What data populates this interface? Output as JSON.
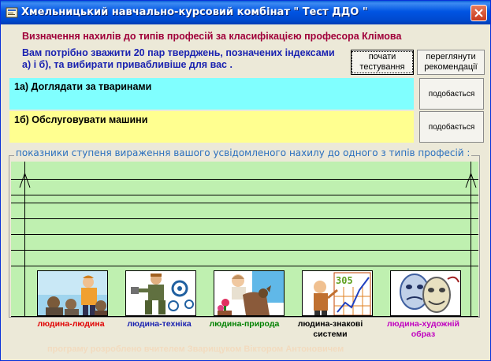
{
  "window": {
    "title": "Хмельницький навчально-курсовий комбінат \" Тест ДДО \""
  },
  "heading": "Визначення нахилів до типів професій за класифікацією професора Клімова",
  "instructions": "Вам потрібно зважити  20 пар тверджень, позначених індексами а) і б), та вибирати привабливіше для вас .",
  "buttons": {
    "start": "почати тестування",
    "recommendations": "переглянути рекомендації",
    "like": "подобається"
  },
  "statements": {
    "a": "1а)  Доглядати за тваринами",
    "b": "1б)  Обслуговувати машини"
  },
  "chart": {
    "legend": "показники ступеня вираження вашого усвідомленого нахилу до одного з типів професій :"
  },
  "categories": [
    {
      "label": "людина-людина",
      "color": "#e00000"
    },
    {
      "label": "людина-техніка",
      "color": "#1a22b0"
    },
    {
      "label": "людина-природа",
      "color": "#008000"
    },
    {
      "label": "людина-знакові системи",
      "color": "#000000"
    },
    {
      "label": "людина-художній образ",
      "color": "#c000c0"
    }
  ],
  "footer": "програму розроблено вчителем  Зварищуком Віктором Антоновичем"
}
